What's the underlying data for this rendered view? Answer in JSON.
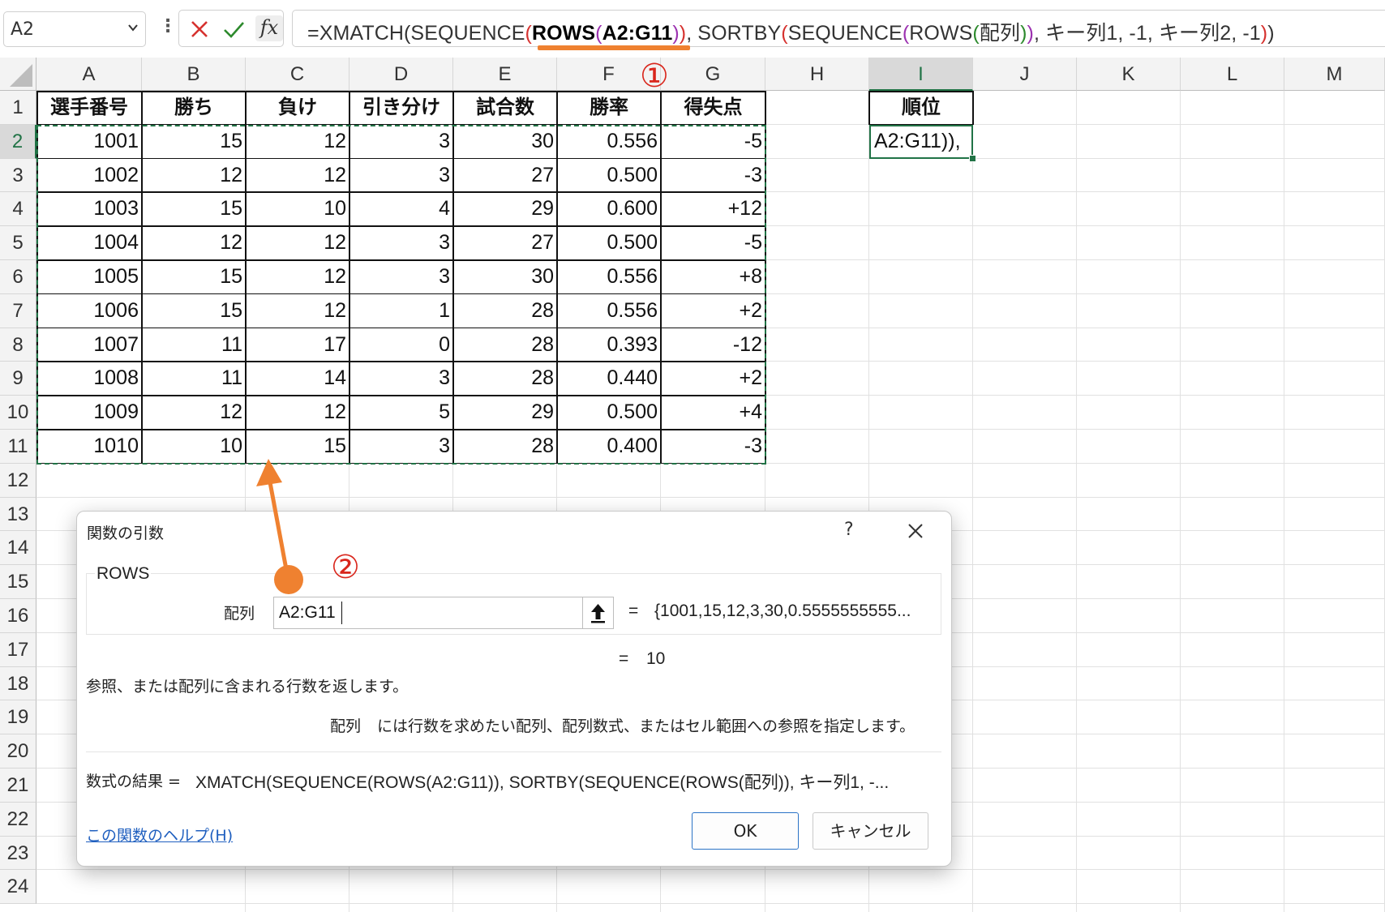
{
  "name_box": {
    "value": "A2"
  },
  "formula_bar": {
    "tokens": [
      {
        "t": "=XMATCH(SEQUENCE",
        "c": ""
      },
      {
        "t": "(",
        "c": "p-red"
      },
      {
        "t": "ROWS",
        "c": "hl-bold"
      },
      {
        "t": "(",
        "c": "p-purple"
      },
      {
        "t": "A2:G11",
        "c": "hl-bold"
      },
      {
        "t": ")",
        "c": "p-purple"
      },
      {
        "t": ")",
        "c": "p-red"
      },
      {
        "t": ", SORTBY",
        "c": ""
      },
      {
        "t": "(",
        "c": "p-red"
      },
      {
        "t": "SEQUENCE",
        "c": ""
      },
      {
        "t": "(",
        "c": "p-purple"
      },
      {
        "t": "ROWS",
        "c": ""
      },
      {
        "t": "(",
        "c": "p-green"
      },
      {
        "t": "配列",
        "c": ""
      },
      {
        "t": ")",
        "c": "p-green"
      },
      {
        "t": ")",
        "c": "p-purple"
      },
      {
        "t": ", キー列1, -1, キー列2, -1",
        "c": ""
      },
      {
        "t": ")",
        "c": "p-red"
      },
      {
        "t": ")",
        "c": ""
      }
    ]
  },
  "columns": [
    "A",
    "B",
    "C",
    "D",
    "E",
    "F",
    "G",
    "H",
    "I",
    "J",
    "K",
    "L",
    "M"
  ],
  "rows": [
    "1",
    "2",
    "3",
    "4",
    "5",
    "6",
    "7",
    "8",
    "9",
    "10",
    "11",
    "12",
    "13",
    "14",
    "15",
    "16",
    "17",
    "18",
    "19",
    "20",
    "21",
    "22",
    "23",
    "24"
  ],
  "table": {
    "headers": [
      "選手番号",
      "勝ち",
      "負け",
      "引き分け",
      "試合数",
      "勝率",
      "得失点"
    ],
    "rows": [
      [
        "1001",
        "15",
        "12",
        "3",
        "30",
        "0.556",
        "-5"
      ],
      [
        "1002",
        "12",
        "12",
        "3",
        "27",
        "0.500",
        "-3"
      ],
      [
        "1003",
        "15",
        "10",
        "4",
        "29",
        "0.600",
        "+12"
      ],
      [
        "1004",
        "12",
        "12",
        "3",
        "27",
        "0.500",
        "-5"
      ],
      [
        "1005",
        "15",
        "12",
        "3",
        "30",
        "0.556",
        "+8"
      ],
      [
        "1006",
        "15",
        "12",
        "1",
        "28",
        "0.556",
        "+2"
      ],
      [
        "1007",
        "11",
        "17",
        "0",
        "28",
        "0.393",
        "-12"
      ],
      [
        "1008",
        "11",
        "14",
        "3",
        "28",
        "0.440",
        "+2"
      ],
      [
        "1009",
        "12",
        "12",
        "5",
        "29",
        "0.500",
        "+4"
      ],
      [
        "1010",
        "10",
        "15",
        "3",
        "28",
        "0.400",
        "-3"
      ]
    ]
  },
  "rank_column": {
    "header": "順位",
    "active_cell_text": "A2:G11)),"
  },
  "markers": {
    "step1": "①",
    "step2": "②"
  },
  "dialog": {
    "title": "関数の引数",
    "help_icon": "?",
    "function_name": "ROWS",
    "arg_label": "配列",
    "arg_value": "A2:G11",
    "arg_preview": "{1001,15,12,3,30,0.5555555555...",
    "function_result": "10",
    "equals": "=",
    "function_description": "参照、または配列に含まれる行数を返します。",
    "arg_desc_name": "配列",
    "arg_description": "には行数を求めたい配列、配列数式、またはセル範囲への参照を指定します。",
    "result_label": "数式の結果 =",
    "result_text": "XMATCH(SEQUENCE(ROWS(A2:G11)), SORTBY(SEQUENCE(ROWS(配列)), キー列1, -...",
    "help_link": "この関数のヘルプ(H)",
    "ok_label": "OK",
    "cancel_label": "キャンセル"
  },
  "colors": {
    "accent_green": "#217346",
    "annotation_orange": "#ef8130",
    "marker_red": "#d9261c"
  }
}
